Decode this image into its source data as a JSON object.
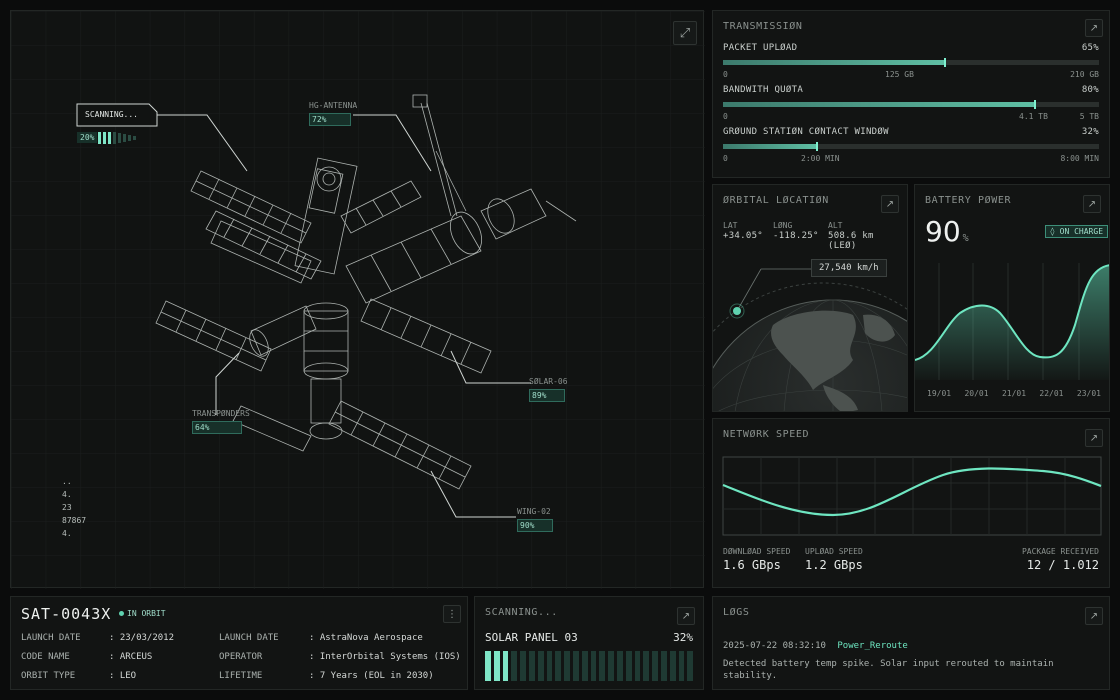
{
  "viewer": {
    "scanning_label": "SCANNING...",
    "scanning_pct": "20%",
    "callouts": [
      {
        "name": "HG-ANTENNA",
        "pct": "72%"
      },
      {
        "name": "SØLAR-06",
        "pct": "89%"
      },
      {
        "name": "TRANSPØNDERS",
        "pct": "64%"
      },
      {
        "name": "WING-02",
        "pct": "90%"
      }
    ],
    "readout": [
      "..",
      "4.",
      "23",
      "87867",
      "4."
    ]
  },
  "transmission": {
    "title": "TRANSMISSIØN",
    "rows": [
      {
        "label": "PACKET UPLØAD",
        "pct": "65%",
        "fill": 0.59,
        "start": "0",
        "mid": "125 GB",
        "end": "210 GB"
      },
      {
        "label": "BANDWITH QUØTA",
        "pct": "80%",
        "fill": 0.83,
        "start": "0",
        "mid": "4.1 TB",
        "end": "5 TB"
      },
      {
        "label": "GRØUND STATIØN CØNTACT WINDØW",
        "pct": "32%",
        "fill": 0.25,
        "start": "0",
        "mid": "2:00 MIN",
        "end": "8:00 MIN"
      }
    ]
  },
  "orbital": {
    "title": "ØRBITAL LØCATIØN",
    "lat_label": "LAT",
    "lat": "+34.05°",
    "long_label": "LØNG",
    "long": "-118.25°",
    "alt_label": "ALT",
    "alt": "508.6 km (LEØ)",
    "speed": "27,540 km/h"
  },
  "battery": {
    "title": "BATTERY PØWER",
    "value": "90",
    "unit": "%",
    "badge": "ON CHARGE",
    "days": [
      "19/01",
      "20/01",
      "21/01",
      "22/01",
      "23/01"
    ]
  },
  "network": {
    "title": "NETWØRK SPEED",
    "download_label": "DØWNLØAD SPEED",
    "download": "1.6 GBps",
    "upload_label": "UPLØAD SPEED",
    "upload": "1.2 GBps",
    "package_label": "PACKAGE RECEIVED",
    "package": "12 / 1.012"
  },
  "sat": {
    "id": "SAT-0043X",
    "status": "IN ORBIT",
    "fields": [
      {
        "label": "LAUNCH DATE",
        "value": ": 23/03/2012"
      },
      {
        "label": "CODE NAME",
        "value": ": ARCEUS"
      },
      {
        "label": "ORBIT TYPE",
        "value": ": LEO"
      },
      {
        "label": "LAUNCH DATE",
        "value": ": AstraNova Aerospace"
      },
      {
        "label": "OPERATOR",
        "value": ": InterOrbital Systems (IOS)"
      },
      {
        "label": "LIFETIME",
        "value": ": 7 Years (EOL in 2030)"
      }
    ],
    "menu_icon": "vertical-dots-icon"
  },
  "scan": {
    "title": "SCANNING...",
    "name": "SOLAR PANEL 03",
    "pct": "32%",
    "progress": 0.32
  },
  "logs": {
    "title": "LØGS",
    "time": "2025-07-22 08:32:10",
    "event": "Power_Reroute",
    "message": "Detected battery temp spike. Solar input rerouted to maintain stability."
  },
  "icons": {
    "expand": "expand-icon",
    "external": "arrow-up-right-icon"
  },
  "colors": {
    "accent": "#5fd3b0",
    "panel": "#121413",
    "bg": "#0b0c0c"
  }
}
